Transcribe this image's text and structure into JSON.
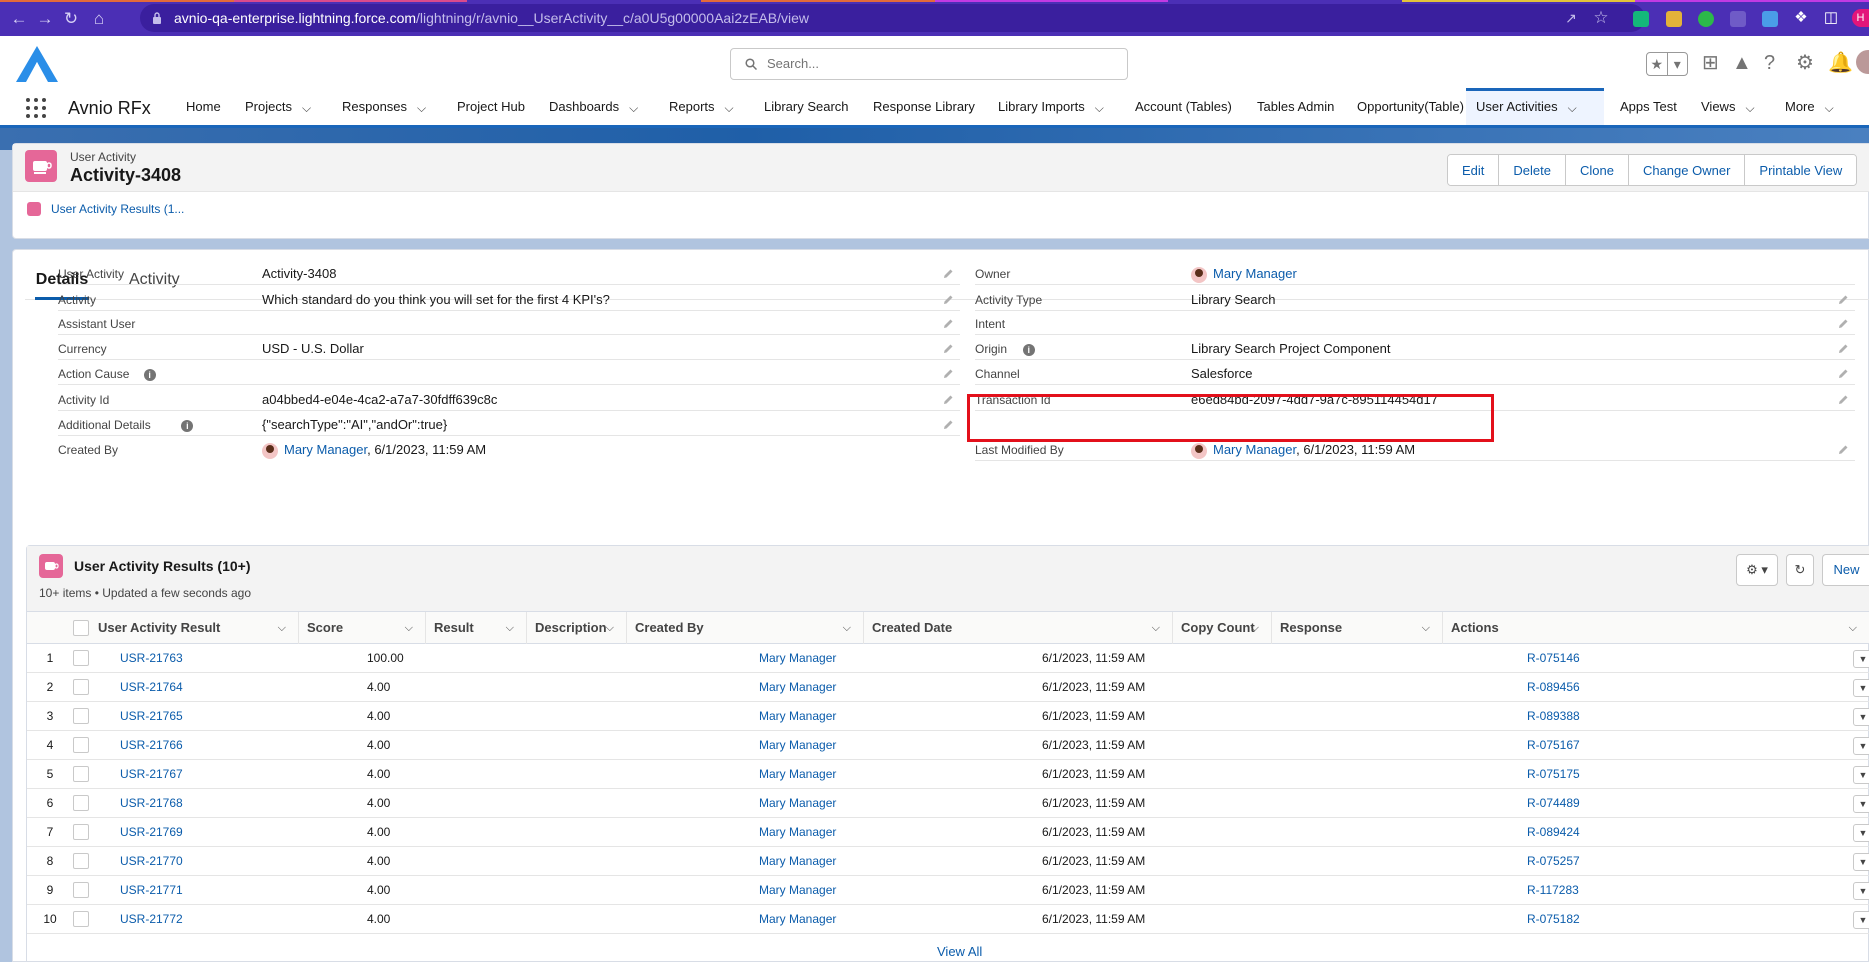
{
  "browser": {
    "url_host": "avnio-qa-enterprise.lightning.force.com",
    "url_path": "/lightning/r/avnio__UserActivity__c/a0U5g00000Aai2zEAB/view",
    "profile_initial": "H"
  },
  "header": {
    "search_placeholder": "Search..."
  },
  "nav": {
    "app_name": "Avnio RFx",
    "items": [
      {
        "label": "Home",
        "dropdown": false
      },
      {
        "label": "Projects",
        "dropdown": true
      },
      {
        "label": "Responses",
        "dropdown": true
      },
      {
        "label": "Project Hub",
        "dropdown": false
      },
      {
        "label": "Dashboards",
        "dropdown": true
      },
      {
        "label": "Reports",
        "dropdown": true
      },
      {
        "label": "Library Search",
        "dropdown": false
      },
      {
        "label": "Response Library",
        "dropdown": false
      },
      {
        "label": "Library Imports",
        "dropdown": true
      },
      {
        "label": "Account (Tables)",
        "dropdown": false
      },
      {
        "label": "Tables Admin",
        "dropdown": false
      },
      {
        "label": "Opportunity(Table)",
        "dropdown": false
      },
      {
        "label": "User Activities",
        "dropdown": true,
        "active": true
      },
      {
        "label": "Apps Test",
        "dropdown": false
      },
      {
        "label": "Views",
        "dropdown": true
      },
      {
        "label": "More",
        "dropdown": true
      }
    ]
  },
  "record": {
    "object_label": "User Activity",
    "title": "Activity-3408",
    "actions": [
      "Edit",
      "Delete",
      "Clone",
      "Change Owner",
      "Printable View"
    ],
    "related_quick_link": "User Activity Results (1..."
  },
  "tabs": [
    "Details",
    "Activity"
  ],
  "fields_left": [
    {
      "label": "User Activity",
      "value": "Activity-3408"
    },
    {
      "label": "Activity",
      "value": "Which standard do you think you will set for the first 4 KPI's?"
    },
    {
      "label": "Assistant User",
      "value": ""
    },
    {
      "label": "Currency",
      "value": "USD - U.S. Dollar"
    },
    {
      "label": "Action Cause",
      "value": "",
      "info": true
    },
    {
      "label": "Activity Id",
      "value": "a04bbed4-e04e-4ca2-a7a7-30fdff639c8c"
    },
    {
      "label": "Additional Details",
      "value": "{\"searchType\":\"AI\",\"andOr\":true}",
      "info": true
    },
    {
      "label": "Created By",
      "user": "Mary Manager",
      "value": ", 6/1/2023, 11:59 AM"
    }
  ],
  "fields_right": [
    {
      "label": "Owner",
      "user": "Mary Manager",
      "value": ""
    },
    {
      "label": "Activity Type",
      "value": "Library Search"
    },
    {
      "label": "Intent",
      "value": ""
    },
    {
      "label": "Origin",
      "value": "Library Search Project Component",
      "info": true
    },
    {
      "label": "Channel",
      "value": "Salesforce"
    },
    {
      "label": "Transaction Id",
      "value": "e6ed84bd-2097-4dd7-9a7c-895114454d17"
    },
    {
      "label": "Last Modified By",
      "user": "Mary Manager",
      "value": ", 6/1/2023, 11:59 AM"
    }
  ],
  "related_list": {
    "title": "User Activity Results (10+)",
    "subtitle": "10+ items • Updated a few seconds ago",
    "new_label": "New",
    "columns": [
      "User Activity Result",
      "Score",
      "Result",
      "Description",
      "Created By",
      "Created Date",
      "Copy Count",
      "Response",
      "Actions"
    ],
    "rows": [
      {
        "num": "1",
        "name": "USR-21763",
        "score": "100.00",
        "created_by": "Mary Manager",
        "created_date": "6/1/2023, 11:59 AM",
        "response": "R-075146"
      },
      {
        "num": "2",
        "name": "USR-21764",
        "score": "4.00",
        "created_by": "Mary Manager",
        "created_date": "6/1/2023, 11:59 AM",
        "response": "R-089456"
      },
      {
        "num": "3",
        "name": "USR-21765",
        "score": "4.00",
        "created_by": "Mary Manager",
        "created_date": "6/1/2023, 11:59 AM",
        "response": "R-089388"
      },
      {
        "num": "4",
        "name": "USR-21766",
        "score": "4.00",
        "created_by": "Mary Manager",
        "created_date": "6/1/2023, 11:59 AM",
        "response": "R-075167"
      },
      {
        "num": "5",
        "name": "USR-21767",
        "score": "4.00",
        "created_by": "Mary Manager",
        "created_date": "6/1/2023, 11:59 AM",
        "response": "R-075175"
      },
      {
        "num": "6",
        "name": "USR-21768",
        "score": "4.00",
        "created_by": "Mary Manager",
        "created_date": "6/1/2023, 11:59 AM",
        "response": "R-074489"
      },
      {
        "num": "7",
        "name": "USR-21769",
        "score": "4.00",
        "created_by": "Mary Manager",
        "created_date": "6/1/2023, 11:59 AM",
        "response": "R-089424"
      },
      {
        "num": "8",
        "name": "USR-21770",
        "score": "4.00",
        "created_by": "Mary Manager",
        "created_date": "6/1/2023, 11:59 AM",
        "response": "R-075257"
      },
      {
        "num": "9",
        "name": "USR-21771",
        "score": "4.00",
        "created_by": "Mary Manager",
        "created_date": "6/1/2023, 11:59 AM",
        "response": "R-117283"
      },
      {
        "num": "10",
        "name": "USR-21772",
        "score": "4.00",
        "created_by": "Mary Manager",
        "created_date": "6/1/2023, 11:59 AM",
        "response": "R-075182"
      }
    ],
    "view_all": "View All"
  },
  "colors": {
    "brand_blue": "#0b5cab",
    "nav_accent": "#1a66ba",
    "object_pink": "#e56798",
    "highlight_red": "#e3101b",
    "browser_purple": "#4b2fb5"
  }
}
